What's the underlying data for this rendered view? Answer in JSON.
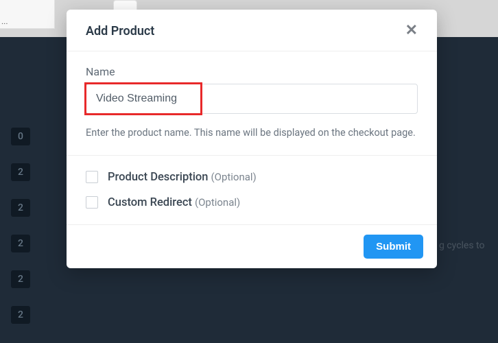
{
  "background": {
    "ellipsis": "...",
    "badges": [
      "0",
      "2",
      "2",
      "2",
      "2",
      "2"
    ],
    "badge_tops": [
      186,
      238,
      290,
      342,
      394,
      446
    ],
    "cycles_text": "g cycles to"
  },
  "modal": {
    "title": "Add Product",
    "name_label": "Name",
    "name_value": "Video Streaming",
    "name_help": "Enter the product name. This name will be displayed on the checkout page.",
    "option1_label": "Product Description",
    "option1_sub": "(Optional)",
    "option2_label": "Custom Redirect",
    "option2_sub": "(Optional)",
    "submit": "Submit"
  }
}
